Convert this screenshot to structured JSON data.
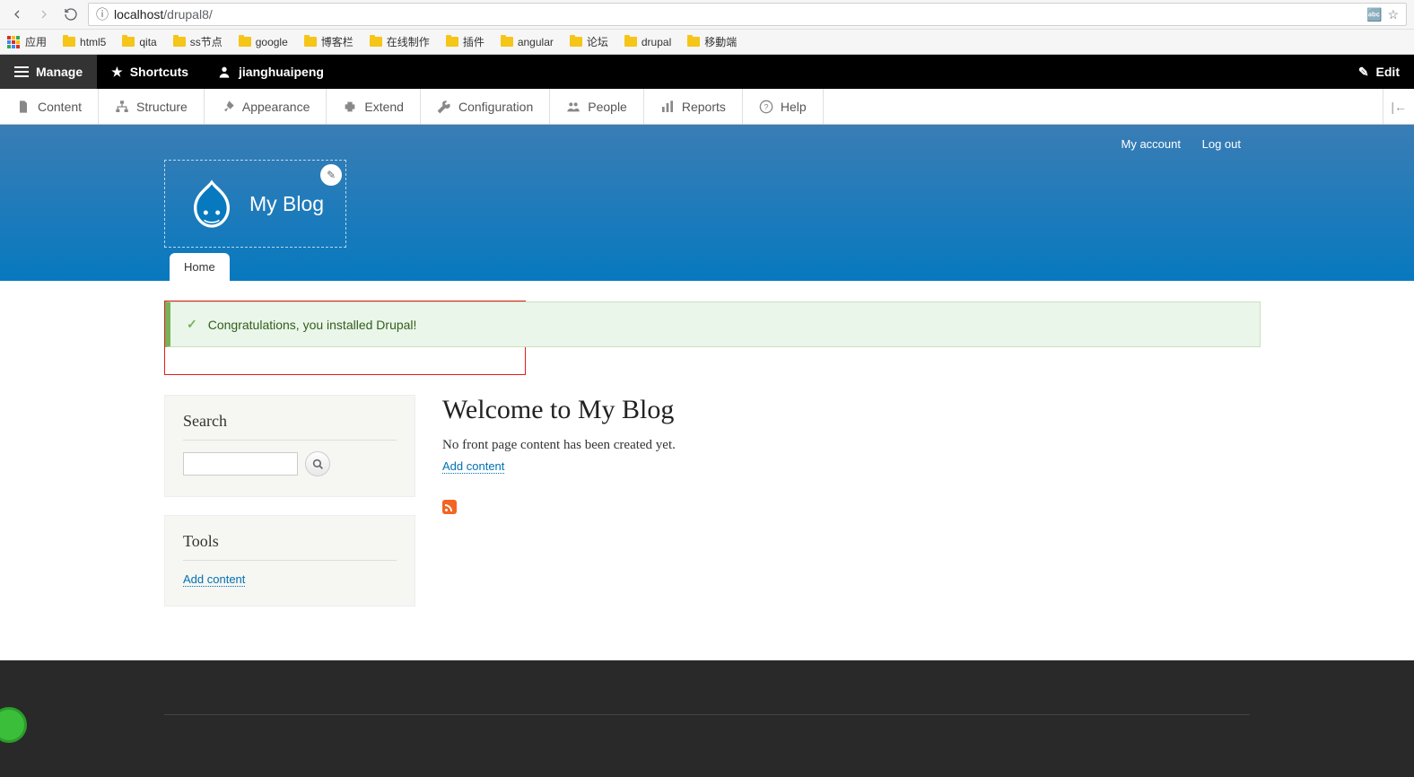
{
  "browser": {
    "url_host": "localhost",
    "url_path": "/drupal8/",
    "apps_label": "应用",
    "bookmarks": [
      "html5",
      "qita",
      "ss节点",
      "google",
      "博客栏",
      "在线制作",
      "插件",
      "angular",
      "论坛",
      "drupal",
      "移動端"
    ]
  },
  "toolbar": {
    "manage": "Manage",
    "shortcuts": "Shortcuts",
    "user": "jianghuaipeng",
    "edit": "Edit"
  },
  "admin_menu": {
    "items": [
      {
        "icon": "file",
        "label": "Content"
      },
      {
        "icon": "hierarchy",
        "label": "Structure"
      },
      {
        "icon": "brush",
        "label": "Appearance"
      },
      {
        "icon": "puzzle",
        "label": "Extend"
      },
      {
        "icon": "wrench",
        "label": "Configuration"
      },
      {
        "icon": "people",
        "label": "People"
      },
      {
        "icon": "barchart",
        "label": "Reports"
      },
      {
        "icon": "help",
        "label": "Help"
      }
    ]
  },
  "header": {
    "my_account": "My account",
    "log_out": "Log out",
    "site_name": "My Blog"
  },
  "tabs": {
    "home": "Home"
  },
  "message": {
    "text": "Congratulations, you installed Drupal!"
  },
  "sidebar": {
    "search_title": "Search",
    "tools_title": "Tools",
    "add_content": "Add content"
  },
  "main": {
    "title": "Welcome to My Blog",
    "empty": "No front page content has been created yet.",
    "add_content": "Add content"
  }
}
